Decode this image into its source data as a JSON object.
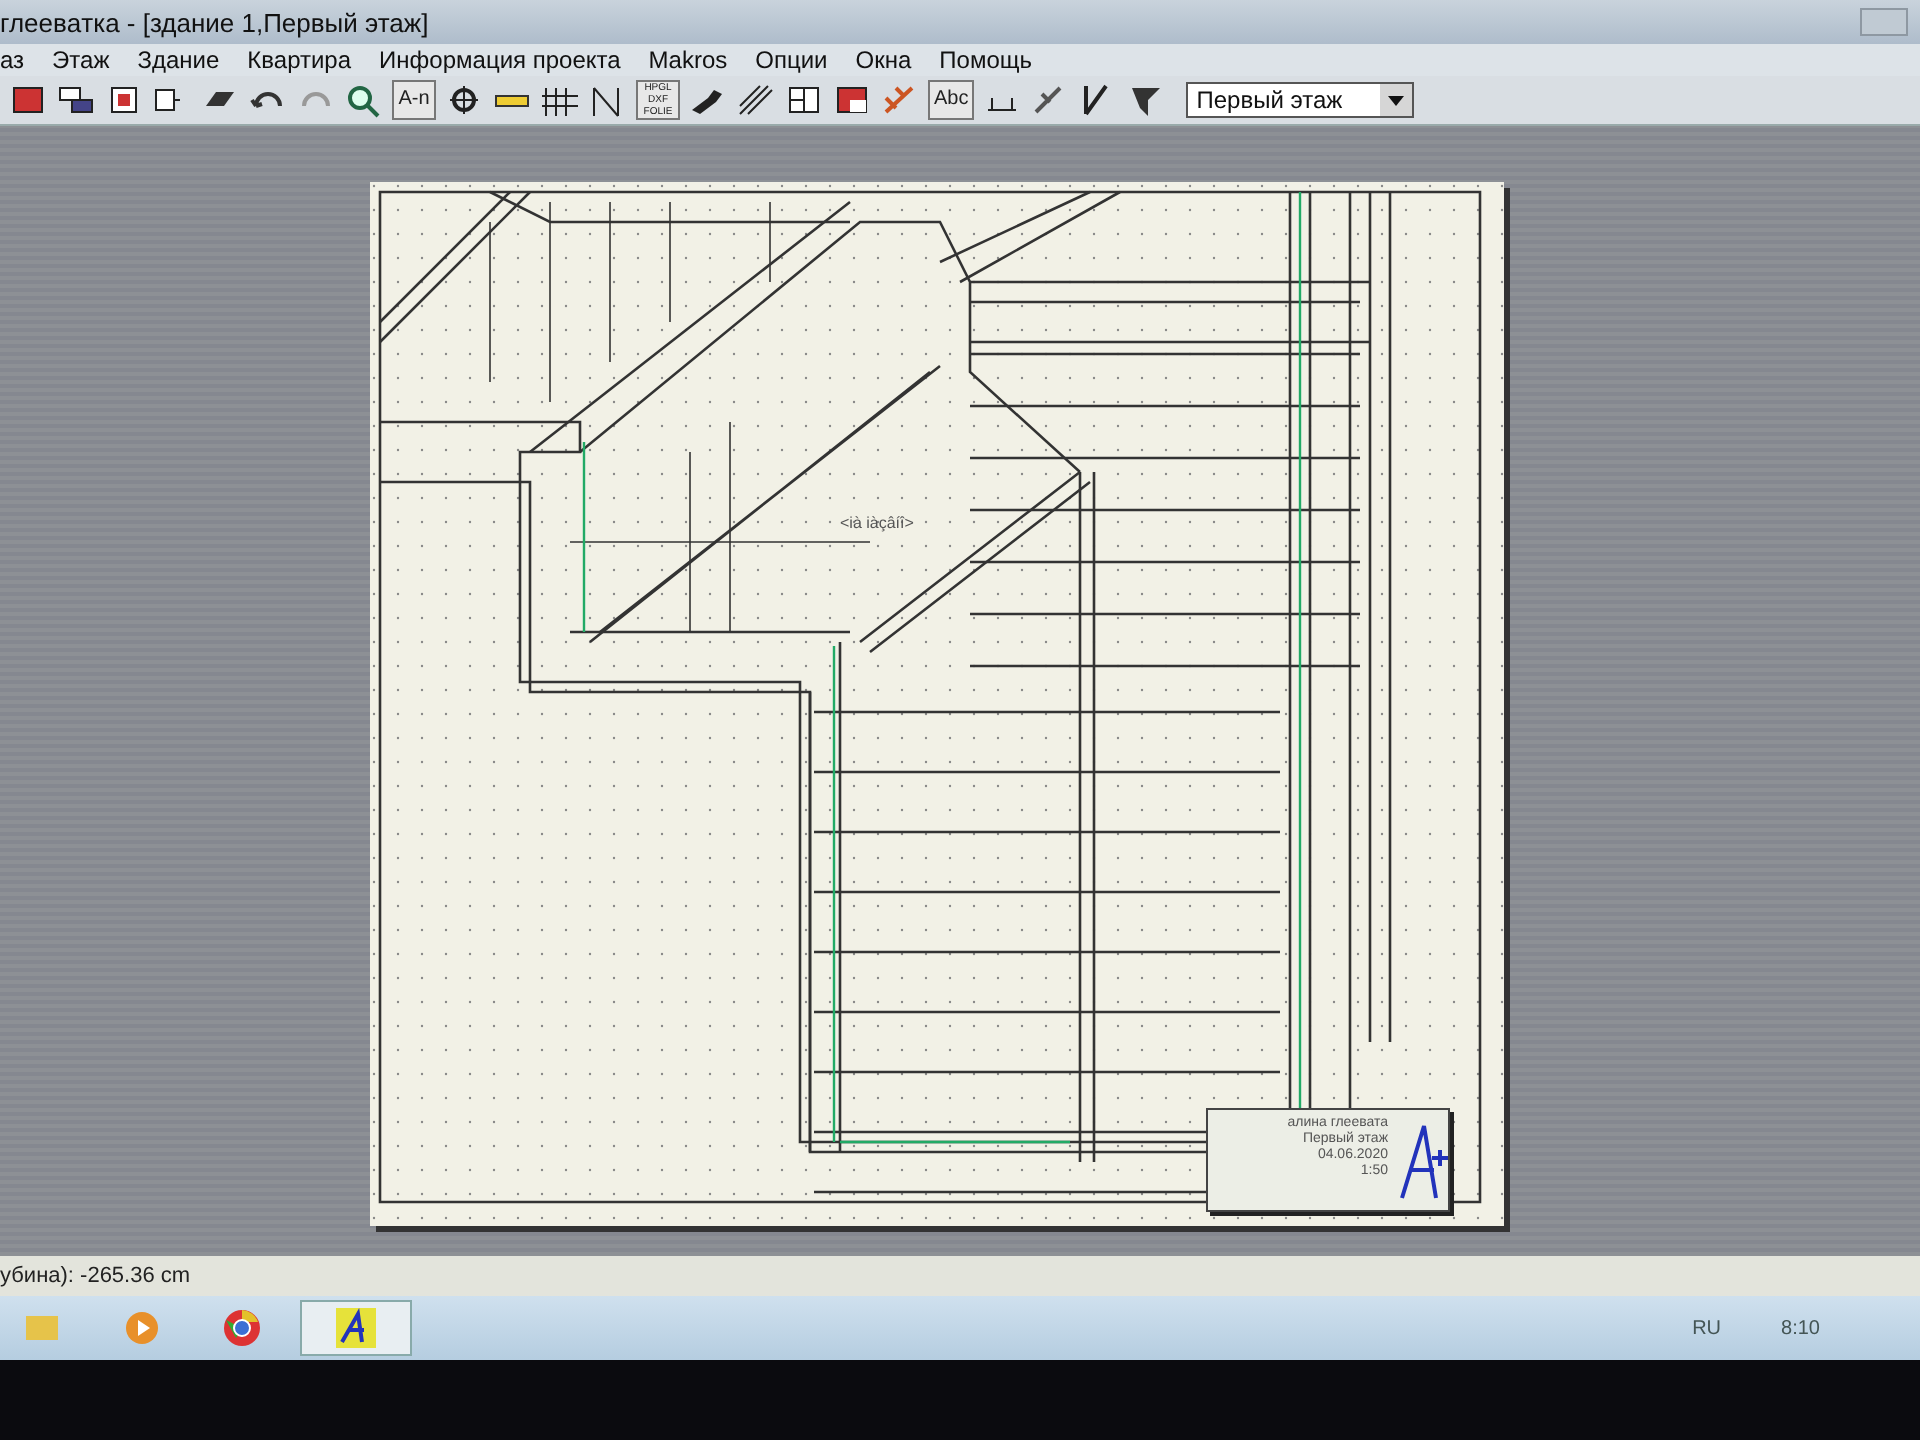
{
  "window": {
    "title": "глеевaтка - [здание 1,Первый этаж]"
  },
  "menu": [
    "аз",
    "Этаж",
    "Здание",
    "Квартира",
    "Информация проекта",
    "Makros",
    "Опции",
    "Окна",
    "Помощь"
  ],
  "toolbar": {
    "text_buttons": [
      {
        "lines": [
          "A-n"
        ]
      },
      {
        "lines": [
          "HPGL",
          "DXF",
          "FOLIE"
        ]
      },
      {
        "lines": [
          "Abc"
        ]
      }
    ],
    "floor_select": {
      "value": "Первый этаж"
    }
  },
  "drawing": {
    "room_label": "<ià iàçâíî>",
    "title_block": [
      "алина глеевата",
      "Первый этаж",
      "04.06.2020",
      "1:50"
    ]
  },
  "status_bar": {
    "text": "убина): -265.36 cm"
  },
  "taskbar": {
    "apps": [
      {
        "selected": false
      },
      {
        "selected": false
      },
      {
        "selected": false
      },
      {
        "selected": true
      }
    ],
    "language": "RU",
    "time": "8:10"
  }
}
